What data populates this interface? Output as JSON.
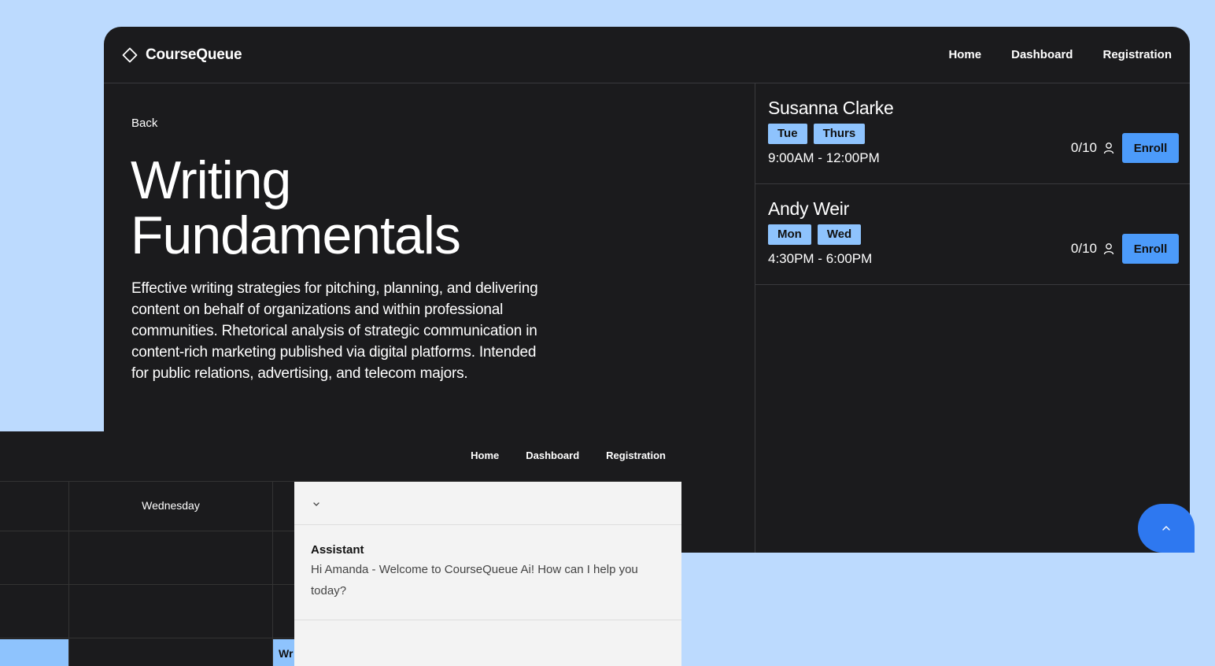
{
  "app": {
    "name": "CourseQueue",
    "nav": [
      "Home",
      "Dashboard",
      "Registration"
    ]
  },
  "course": {
    "back_label": "Back",
    "title_line1": "Writing",
    "title_line2": "Fundamentals",
    "description": "Effective writing strategies for pitching, planning, and delivering content on behalf of organizations and within professional communities. Rhetorical analysis of strategic communication in content-rich marketing published via digital platforms. Intended for public relations, advertising, and telecom majors."
  },
  "sections": [
    {
      "instructor": "Susanna Clarke",
      "days": [
        "Tue",
        "Thurs"
      ],
      "time": "9:00AM - 12:00PM",
      "seats": "0/10",
      "enroll_label": "Enroll"
    },
    {
      "instructor": "Andy Weir",
      "days": [
        "Mon",
        "Wed"
      ],
      "time": "4:30PM - 6:00PM",
      "seats": "0/10",
      "enroll_label": "Enroll"
    }
  ],
  "second_window": {
    "nav": [
      "Home",
      "Dashboard",
      "Registration"
    ],
    "calendar": {
      "day_header": "Wednesday",
      "event_label": "Wr"
    },
    "chat": {
      "role": "Assistant",
      "message": "Hi Amanda - Welcome to CourseQueue Ai! How can I help you today?"
    }
  },
  "colors": {
    "background": "#bcdafe",
    "panel": "#1b1b1d",
    "chip": "#8ec3fd",
    "button": "#4c9bfa",
    "fab": "#2e78f0"
  },
  "icons": [
    "diamond-logo-icon",
    "person-icon",
    "chevron-up-icon",
    "chevron-down-icon"
  ]
}
